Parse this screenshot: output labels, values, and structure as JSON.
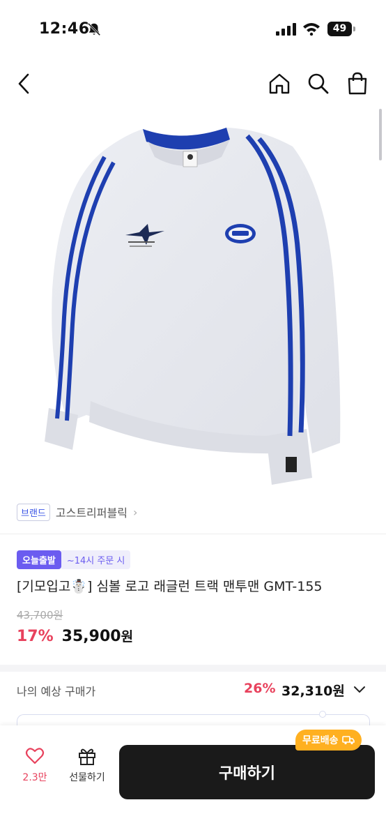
{
  "status_bar": {
    "time": "12:46",
    "battery": "49"
  },
  "nav": {
    "icons": [
      "back-icon",
      "home-icon",
      "search-icon",
      "bag-icon"
    ]
  },
  "brand": {
    "tag": "브랜드",
    "name": "고스트리퍼블릭",
    "chevron": "›"
  },
  "badges": {
    "today": "오늘출발",
    "cutoff": "~14시 주문 시"
  },
  "product": {
    "title": "[기모입고☃️] 심볼 로고 래글런 트랙 맨투맨 GMT-155",
    "original_price": "43,700원",
    "discount": "17%",
    "sale_price": "35,900",
    "sale_unit": "원"
  },
  "expected": {
    "label": "나의 예상 구매가",
    "discount": "26%",
    "price": "32,310원"
  },
  "bottom_bar": {
    "like_count": "2.3만",
    "gift_label": "선물하기",
    "buy_label": "구매하기",
    "free_shipping": "무료배송"
  },
  "colors": {
    "accent_red": "#e8425d",
    "badge_purple": "#6b5cf0",
    "buy_button": "#1a1a1a",
    "free_ship": "#ffb020",
    "brand_blue": "#3b55e6"
  }
}
